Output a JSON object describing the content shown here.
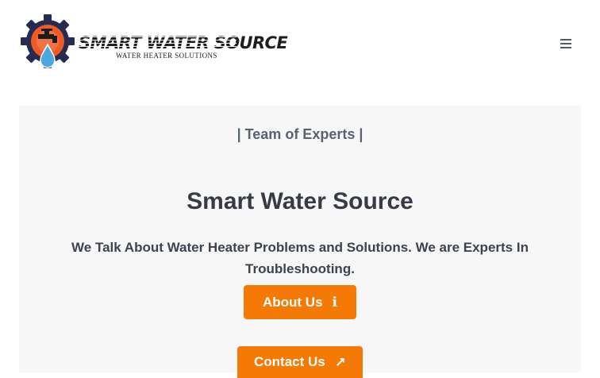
{
  "header": {
    "logo": {
      "brand_text": "SMART WATER SOURCE",
      "tagline": "WATER HEATER SOLUTIONS",
      "colors": {
        "orange": "#ef5a24",
        "navy": "#262b4f",
        "drop": "#4aa8de"
      }
    },
    "menu_icon": "hamburger-menu-icon"
  },
  "hero": {
    "eyebrow": "| Team of Experts |",
    "title": "Smart Water Source",
    "subtitle": "We Talk About Water Heater Problems and Solutions. We are Experts In Troubleshooting.",
    "buttons": [
      {
        "label": "About Us",
        "icon": "info-icon",
        "glyph": "ℹ"
      },
      {
        "label": "Contact Us",
        "icon": "arrow-up-icon",
        "glyph": "↗"
      }
    ]
  },
  "colors": {
    "accent": "#f47a05",
    "hero_bg": "#f7f7f7",
    "heading": "#363b45"
  }
}
